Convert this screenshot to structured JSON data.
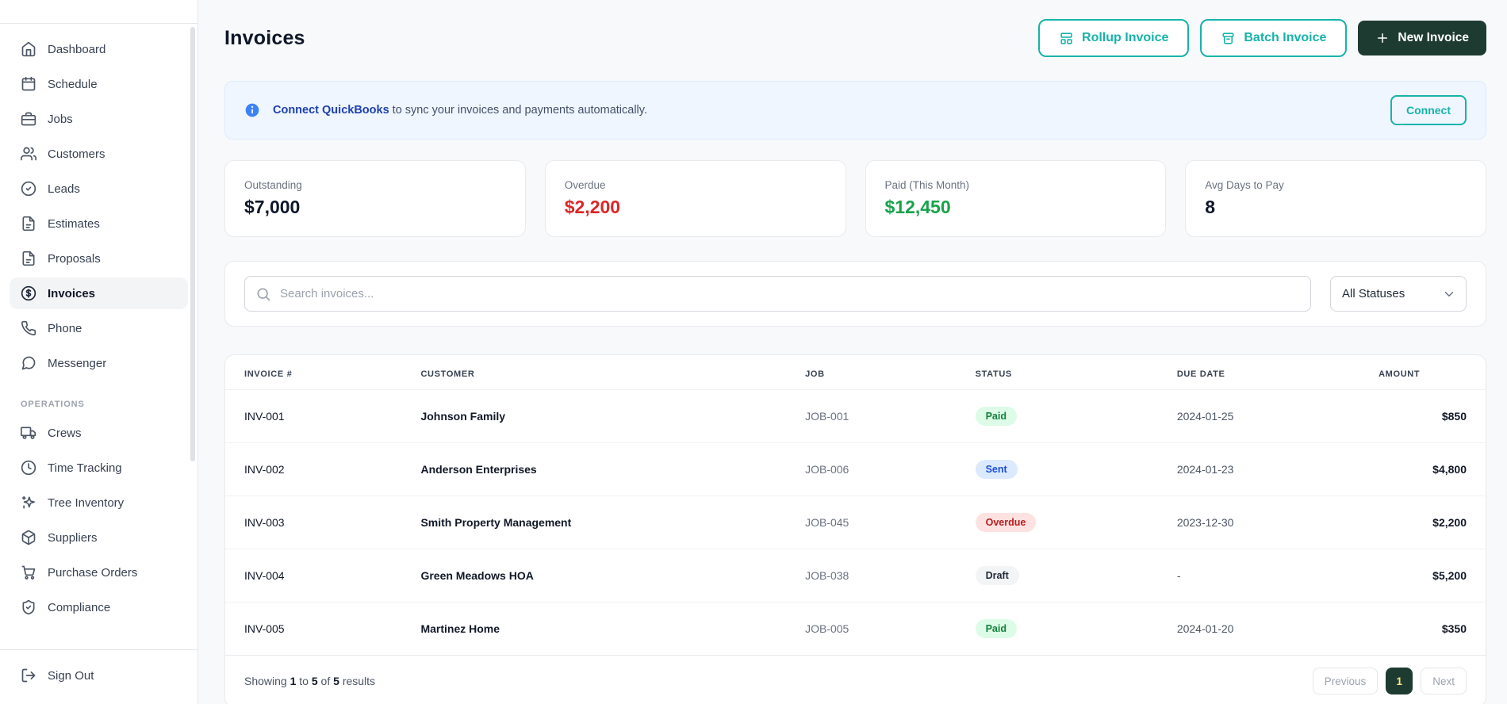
{
  "colors": {
    "accent_teal": "#16b3aa",
    "dark_green": "#1e3b31",
    "overdue_red": "#dc2626",
    "paid_green": "#16a34a",
    "info_blue": "#3b82f6"
  },
  "sidebar": {
    "items": [
      {
        "label": "Dashboard",
        "icon": "home-icon"
      },
      {
        "label": "Schedule",
        "icon": "calendar-icon"
      },
      {
        "label": "Jobs",
        "icon": "briefcase-icon"
      },
      {
        "label": "Customers",
        "icon": "users-icon"
      },
      {
        "label": "Leads",
        "icon": "check-circle-icon"
      },
      {
        "label": "Estimates",
        "icon": "document-icon"
      },
      {
        "label": "Proposals",
        "icon": "document-icon"
      },
      {
        "label": "Invoices",
        "icon": "dollar-circle-icon",
        "active": true
      },
      {
        "label": "Phone",
        "icon": "phone-icon"
      },
      {
        "label": "Messenger",
        "icon": "chat-icon"
      }
    ],
    "section_label": "OPERATIONS",
    "operations": [
      {
        "label": "Crews",
        "icon": "truck-icon"
      },
      {
        "label": "Time Tracking",
        "icon": "clock-icon"
      },
      {
        "label": "Tree Inventory",
        "icon": "sparkles-icon"
      },
      {
        "label": "Suppliers",
        "icon": "package-icon"
      },
      {
        "label": "Purchase Orders",
        "icon": "cart-icon"
      },
      {
        "label": "Compliance",
        "icon": "shield-check-icon"
      }
    ],
    "sign_out_label": "Sign Out"
  },
  "header": {
    "title": "Invoices",
    "rollup_button": "Rollup Invoice",
    "batch_button": "Batch Invoice",
    "new_button": "New Invoice"
  },
  "banner": {
    "bold_text": "Connect QuickBooks",
    "text": "to sync your invoices and payments automatically.",
    "connect_button": "Connect"
  },
  "stats": [
    {
      "label": "Outstanding",
      "value": "$7,000"
    },
    {
      "label": "Overdue",
      "value": "$2,200"
    },
    {
      "label": "Paid (This Month)",
      "value": "$12,450"
    },
    {
      "label": "Avg Days to Pay",
      "value": "8"
    }
  ],
  "filters": {
    "search_placeholder": "Search invoices...",
    "status_filter_value": "All Statuses"
  },
  "table": {
    "columns": [
      "INVOICE #",
      "CUSTOMER",
      "JOB",
      "STATUS",
      "DUE DATE",
      "AMOUNT"
    ],
    "rows": [
      {
        "invoice": "INV-001",
        "customer": "Johnson Family",
        "job": "JOB-001",
        "status": "Paid",
        "due_date": "2024-01-25",
        "amount": "$850"
      },
      {
        "invoice": "INV-002",
        "customer": "Anderson Enterprises",
        "job": "JOB-006",
        "status": "Sent",
        "due_date": "2024-01-23",
        "amount": "$4,800"
      },
      {
        "invoice": "INV-003",
        "customer": "Smith Property Management",
        "job": "JOB-045",
        "status": "Overdue",
        "due_date": "2023-12-30",
        "amount": "$2,200"
      },
      {
        "invoice": "INV-004",
        "customer": "Green Meadows HOA",
        "job": "JOB-038",
        "status": "Draft",
        "due_date": "-",
        "amount": "$5,200"
      },
      {
        "invoice": "INV-005",
        "customer": "Martinez Home",
        "job": "JOB-005",
        "status": "Paid",
        "due_date": "2024-01-20",
        "amount": "$350"
      }
    ]
  },
  "pagination": {
    "prefix": "Showing",
    "from": "1",
    "to_word": "to",
    "to": "5",
    "of_word": "of",
    "total": "5",
    "results_word": "results",
    "previous_label": "Previous",
    "current_page": "1",
    "next_label": "Next"
  }
}
